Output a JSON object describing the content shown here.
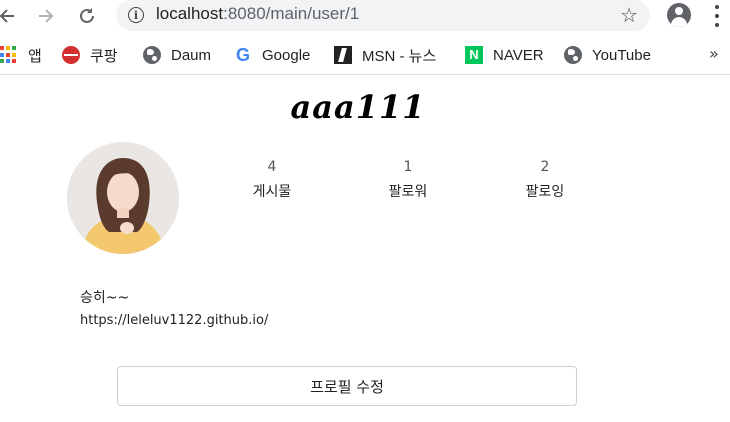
{
  "browser": {
    "url_host": "localhost",
    "url_path": ":8080/main/user/1",
    "bookmarks": [
      {
        "label": "앱",
        "icon": "apps-grid-icon"
      },
      {
        "label": "쿠팡",
        "icon": "coupang-icon"
      },
      {
        "label": "Daum",
        "icon": "globe-icon"
      },
      {
        "label": "Google",
        "icon": "google-icon"
      },
      {
        "label": "MSN - 뉴스",
        "icon": "msn-icon"
      },
      {
        "label": "NAVER",
        "icon": "naver-icon"
      },
      {
        "label": "YouTube",
        "icon": "globe-icon"
      }
    ],
    "more_label": "»"
  },
  "profile": {
    "username": "aaa111",
    "stats": [
      {
        "value": "4",
        "label": "게시물"
      },
      {
        "value": "1",
        "label": "팔로워"
      },
      {
        "value": "2",
        "label": "팔로잉"
      }
    ],
    "bio_name": "승히~~",
    "bio_link": "https://leleluv1122.github.io/",
    "edit_button": "프로필 수정"
  },
  "colors": {
    "omnibox_bg": "#f1f3f4",
    "naver_green": "#03c75a",
    "coupang_red": "#d32f2f"
  }
}
